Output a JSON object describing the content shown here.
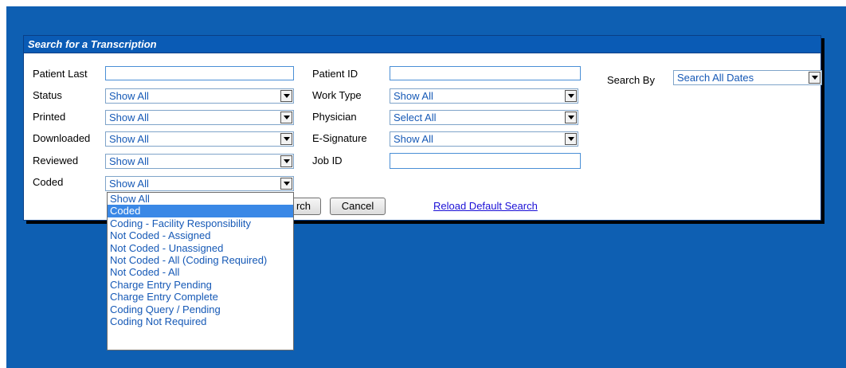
{
  "panel": {
    "title": "Search for a Transcription"
  },
  "left_fields": [
    {
      "label": "Patient Last",
      "kind": "text",
      "value": ""
    },
    {
      "label": "Status",
      "kind": "select",
      "value": "Show All"
    },
    {
      "label": "Printed",
      "kind": "select",
      "value": "Show All"
    },
    {
      "label": "Downloaded",
      "kind": "select",
      "value": "Show All"
    },
    {
      "label": "Reviewed",
      "kind": "select",
      "value": "Show All"
    },
    {
      "label": "Coded",
      "kind": "select",
      "value": "Show All"
    }
  ],
  "middle_fields": [
    {
      "label": "Patient ID",
      "kind": "text",
      "value": ""
    },
    {
      "label": "Work Type",
      "kind": "select",
      "value": "Show All"
    },
    {
      "label": "Physician",
      "kind": "select",
      "value": "Select All"
    },
    {
      "label": "E-Signature",
      "kind": "select",
      "value": "Show All"
    },
    {
      "label": "Job ID",
      "kind": "text",
      "value": ""
    }
  ],
  "search_by": {
    "label": "Search By",
    "value": "Search All Dates"
  },
  "buttons": {
    "search": "rch",
    "cancel": "Cancel"
  },
  "reload_link": "Reload Default Search",
  "coded_dropdown": {
    "selected_index": 1,
    "options": [
      "Show All",
      "Coded",
      "Coding - Facility Responsibility",
      "Not Coded - Assigned",
      "Not Coded - Unassigned",
      "Not Coded - All (Coding Required)",
      "Not Coded - All",
      "Charge Entry Pending",
      "Charge Entry Complete",
      "Coding Query / Pending",
      "Coding Not Required"
    ]
  },
  "colors": {
    "background": "#0e5fb2",
    "title_bar": "#0a5bb5",
    "select_text": "#1659b6",
    "highlight": "#3a88e6"
  }
}
